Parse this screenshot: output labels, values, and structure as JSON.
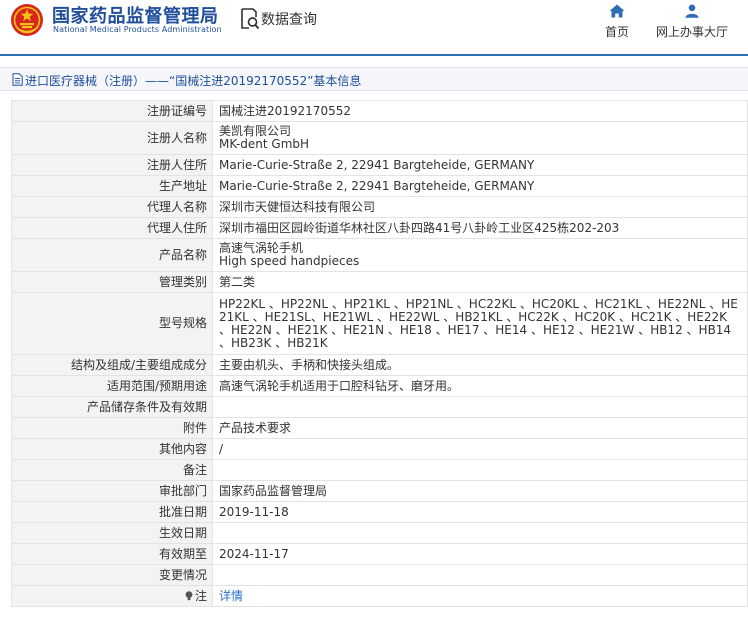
{
  "header": {
    "org_name_cn": "国家药品监督管理局",
    "org_name_en": "National Medical Products Administration",
    "logo_icon": "national-emblem-icon",
    "data_query_icon": "search-document-icon",
    "data_query_label": "数据查询",
    "nav": [
      {
        "label": "首页",
        "icon": "home-icon"
      },
      {
        "label": "网上办事大厅",
        "icon": "person-icon"
      }
    ],
    "accent_color": "#2f6db5"
  },
  "page_title": "进口医疗器械（注册）——“国械注进20192170552”基本信息",
  "rows": [
    {
      "label": "注册证编号",
      "value": "国械注进20192170552"
    },
    {
      "label": "注册人名称",
      "value": "美凯有限公司",
      "value2": "MK-dent GmbH"
    },
    {
      "label": "注册人住所",
      "value": "Marie-Curie-Straße 2, 22941 Bargteheide, GERMANY"
    },
    {
      "label": "生产地址",
      "value": "Marie-Curie-Straße 2, 22941 Bargteheide, GERMANY"
    },
    {
      "label": "代理人名称",
      "value": "深圳市天健恒达科技有限公司"
    },
    {
      "label": "代理人住所",
      "value": "深圳市福田区园岭街道华林社区八卦四路41号八卦岭工业区425栋202-203"
    },
    {
      "label": "产品名称",
      "value": "高速气涡轮手机",
      "value2": "High speed handpieces"
    },
    {
      "label": "管理类别",
      "value": "第二类"
    },
    {
      "label": "型号规格",
      "value": "HP22KL 、HP22NL 、HP21KL 、HP21NL 、HC22KL 、HC20KL 、HC21KL 、HE22NL 、HE21KL 、HE21SL、HE21WL 、HE22WL 、HB21KL 、HC22K 、HC20K 、HC21K 、HE22K 、HE22N 、HE21K 、HE21N 、HE18 、HE17 、HE14 、HE12 、HE21W 、HB12 、HB14 、HB23K 、HB21K"
    },
    {
      "label": "结构及组成/主要组成成分",
      "value": "主要由机头、手柄和快接头组成。"
    },
    {
      "label": "适用范围/预期用途",
      "value": "高速气涡轮手机适用于口腔科钻牙、磨牙用。"
    },
    {
      "label": "产品储存条件及有效期",
      "value": ""
    },
    {
      "label": "附件",
      "value": "产品技术要求"
    },
    {
      "label": "其他内容",
      "value": "/"
    },
    {
      "label": "备注",
      "value": ""
    },
    {
      "label": "审批部门",
      "value": "国家药品监督管理局"
    },
    {
      "label": "批准日期",
      "value": "2019-11-18"
    },
    {
      "label": "生效日期",
      "value": ""
    },
    {
      "label": "有效期至",
      "value": "2024-11-17"
    },
    {
      "label": "变更情况",
      "value": ""
    },
    {
      "label": "注",
      "icon": "bulb-icon",
      "value": "详情"
    }
  ]
}
